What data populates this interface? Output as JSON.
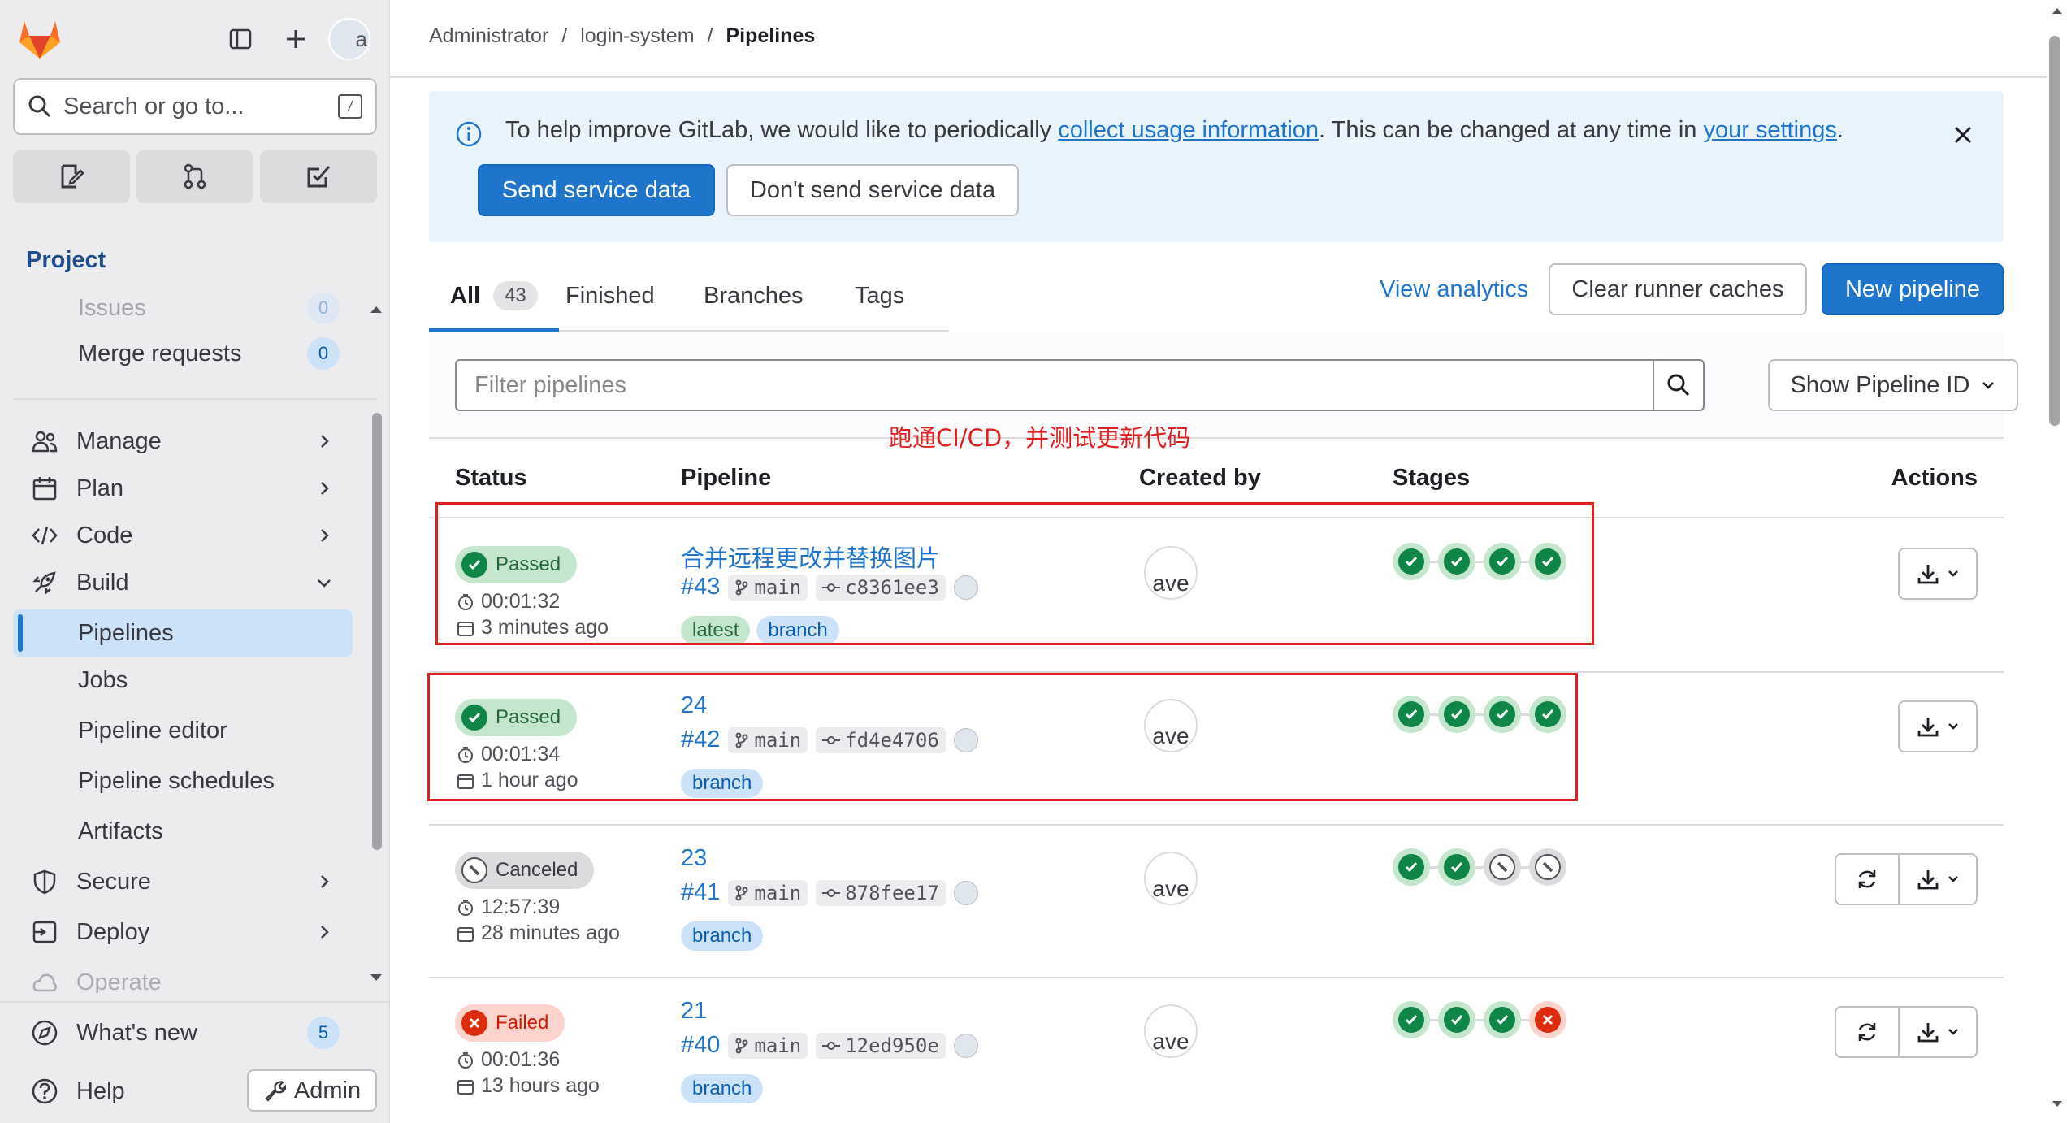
{
  "sidebar": {
    "search_placeholder": "Search or go to...",
    "search_shortcut": "/",
    "section_title": "Project",
    "partial_top_item": "Issues",
    "partial_top_count": "0",
    "merge_requests": {
      "label": "Merge requests",
      "count": "0"
    },
    "items": [
      {
        "label": "Manage"
      },
      {
        "label": "Plan"
      },
      {
        "label": "Code"
      },
      {
        "label": "Build"
      }
    ],
    "build_sub": [
      "Pipelines",
      "Jobs",
      "Pipeline editor",
      "Pipeline schedules",
      "Artifacts"
    ],
    "items_after": [
      {
        "label": "Secure"
      },
      {
        "label": "Deploy"
      }
    ],
    "partial_bottom_item": "Operate",
    "whats_new": {
      "label": "What's new",
      "count": "5"
    },
    "help": "Help",
    "admin": "Admin",
    "avatar_letter": "a"
  },
  "breadcrumb": [
    "Administrator",
    "login-system",
    "Pipelines"
  ],
  "alert": {
    "text_1": "To help improve GitLab, we would like to periodically ",
    "link_1": "collect usage information",
    "text_2": ". This can be changed at any time in ",
    "link_2": "your settings",
    "text_3": ".",
    "send": "Send service data",
    "dont_send": "Don't send service data"
  },
  "tabs": [
    {
      "label": "All",
      "count": "43"
    },
    {
      "label": "Finished"
    },
    {
      "label": "Branches"
    },
    {
      "label": "Tags"
    }
  ],
  "toolbar": {
    "view_analytics": "View analytics",
    "clear_caches": "Clear runner caches",
    "new_pipeline": "New pipeline"
  },
  "filter": {
    "placeholder": "Filter pipelines",
    "sort_label": "Show Pipeline ID"
  },
  "annotation": "跑通CI/CD，并测试更新代码",
  "table": {
    "headers": [
      "Status",
      "Pipeline",
      "Created by",
      "Stages",
      "Actions"
    ],
    "rows": [
      {
        "status": "Passed",
        "duration": "00:01:32",
        "ago": "3 minutes ago",
        "title": "合并远程更改并替换图片",
        "id": "#43",
        "ref": "main",
        "sha": "c8361ee3",
        "tags": [
          "latest",
          "branch"
        ],
        "creator": "ave",
        "stages": [
          "success",
          "success",
          "success",
          "success"
        ],
        "retry": false
      },
      {
        "status": "Passed",
        "duration": "00:01:34",
        "ago": "1 hour ago",
        "title": "24",
        "id": "#42",
        "ref": "main",
        "sha": "fd4e4706",
        "tags": [
          "branch"
        ],
        "creator": "ave",
        "stages": [
          "success",
          "success",
          "success",
          "success"
        ],
        "retry": false
      },
      {
        "status": "Canceled",
        "duration": "12:57:39",
        "ago": "28 minutes ago",
        "title": "23",
        "id": "#41",
        "ref": "main",
        "sha": "878fee17",
        "tags": [
          "branch"
        ],
        "creator": "ave",
        "stages": [
          "success",
          "success",
          "canceled",
          "canceled"
        ],
        "retry": true
      },
      {
        "status": "Failed",
        "duration": "00:01:36",
        "ago": "13 hours ago",
        "title": "21",
        "id": "#40",
        "ref": "main",
        "sha": "12ed950e",
        "tags": [
          "branch"
        ],
        "creator": "ave",
        "stages": [
          "success",
          "success",
          "success",
          "failed"
        ],
        "retry": true
      }
    ]
  },
  "colors": {
    "accent": "#1f75cb",
    "success": "#108548",
    "failed": "#dd2b0e",
    "annotation_red": "#e02020"
  }
}
